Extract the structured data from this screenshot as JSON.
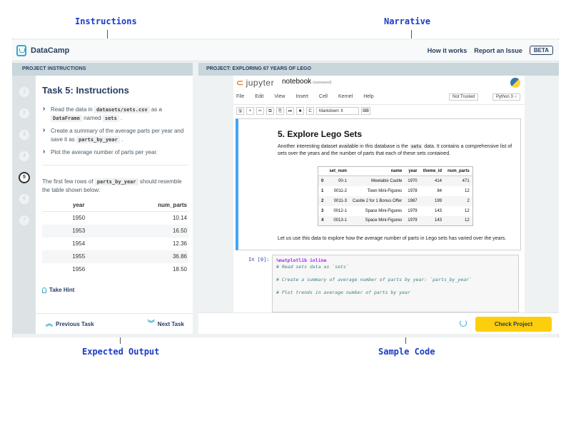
{
  "callouts": {
    "instructions": "Instructions",
    "narrative": "Narrative",
    "expected_output": "Expected Output",
    "sample_code": "Sample Code"
  },
  "app": {
    "brand": "DataCamp",
    "nav": [
      "How it works",
      "Report an Issue"
    ],
    "beta": "BETA"
  },
  "left": {
    "header": "PROJECT INSTRUCTIONS",
    "steps": [
      "1",
      "2",
      "3",
      "4",
      "5",
      "6",
      "7"
    ],
    "active_step": "5",
    "task_title": "Task 5: Instructions",
    "bullets": [
      {
        "pre": "Read the data in",
        "code1": "datasets/sets.csv",
        "mid": "as a",
        "code2": "DataFrame",
        "mid2": "named",
        "code3": "sets",
        "post": "."
      },
      {
        "pre": "Create a summary of the average parts per year and save it as",
        "code1": "parts_by_year",
        "post": "."
      },
      {
        "text": "Plot the average number of parts per year."
      }
    ],
    "intro_pre": "The first few rows of",
    "intro_code": "parts_by_year",
    "intro_post": "should resemble the table shown below:",
    "table": {
      "headers": [
        "year",
        "num_parts"
      ],
      "rows": [
        [
          "1950",
          "10.14"
        ],
        [
          "1953",
          "16.50"
        ],
        [
          "1954",
          "12.36"
        ],
        [
          "1955",
          "36.86"
        ],
        [
          "1956",
          "18.50"
        ]
      ]
    },
    "hint": "Take Hint",
    "prev": "Previous Task",
    "next": "Next Task"
  },
  "right": {
    "header": "PROJECT: EXPLORING 67 YEARS OF LEGO",
    "jupyter": "jupyter",
    "notebook": "notebook",
    "autosaved": "(autosaved)",
    "menu": [
      "File",
      "Edit",
      "View",
      "Insert",
      "Cell",
      "Kernel",
      "Help"
    ],
    "trusted": "Not Trusted",
    "kernel": "Python 3",
    "toolbar": [
      "🖫",
      "+",
      "✂",
      "⧉",
      "⎘",
      "⏭",
      "■",
      "C"
    ],
    "cell_type": "Markdown",
    "md_title": "5. Explore Lego Sets",
    "md_pre": "Another interesting dataset available in this database is the",
    "md_code": "sets",
    "md_post": "data. It contains a comprehensive list of sets over the years and the number of parts that each of these sets contained.",
    "df": {
      "headers": [
        "",
        "set_num",
        "name",
        "year",
        "theme_id",
        "num_parts"
      ],
      "rows": [
        [
          "0",
          "00-1",
          "Weetabix Castle",
          "1970",
          "414",
          "471"
        ],
        [
          "1",
          "0011-2",
          "Town Mini-Figures",
          "1978",
          "84",
          "12"
        ],
        [
          "2",
          "0011-3",
          "Castle 2 for 1 Bonus Offer",
          "1987",
          "199",
          "2"
        ],
        [
          "3",
          "0012-1",
          "Space Mini-Figures",
          "1979",
          "143",
          "12"
        ],
        [
          "4",
          "0013-1",
          "Space Mini-Figures",
          "1979",
          "143",
          "12"
        ]
      ]
    },
    "md_text2": "Let us use this data to explore how the average number of parts in Lego sets has varied over the years.",
    "prompt": "In [0]:",
    "code_lines": [
      {
        "kind": "kw",
        "text": "%matplotlib inline"
      },
      {
        "kind": "cm",
        "text": "# Read sets data as `sets`"
      },
      {
        "kind": "cm",
        "text": ""
      },
      {
        "kind": "cm",
        "text": "# Create a summary of average number of parts by year: `parts_by_year`"
      },
      {
        "kind": "cm",
        "text": ""
      },
      {
        "kind": "cm",
        "text": "# Plot trends in average number of parts by year"
      }
    ],
    "check": "Check Project"
  }
}
